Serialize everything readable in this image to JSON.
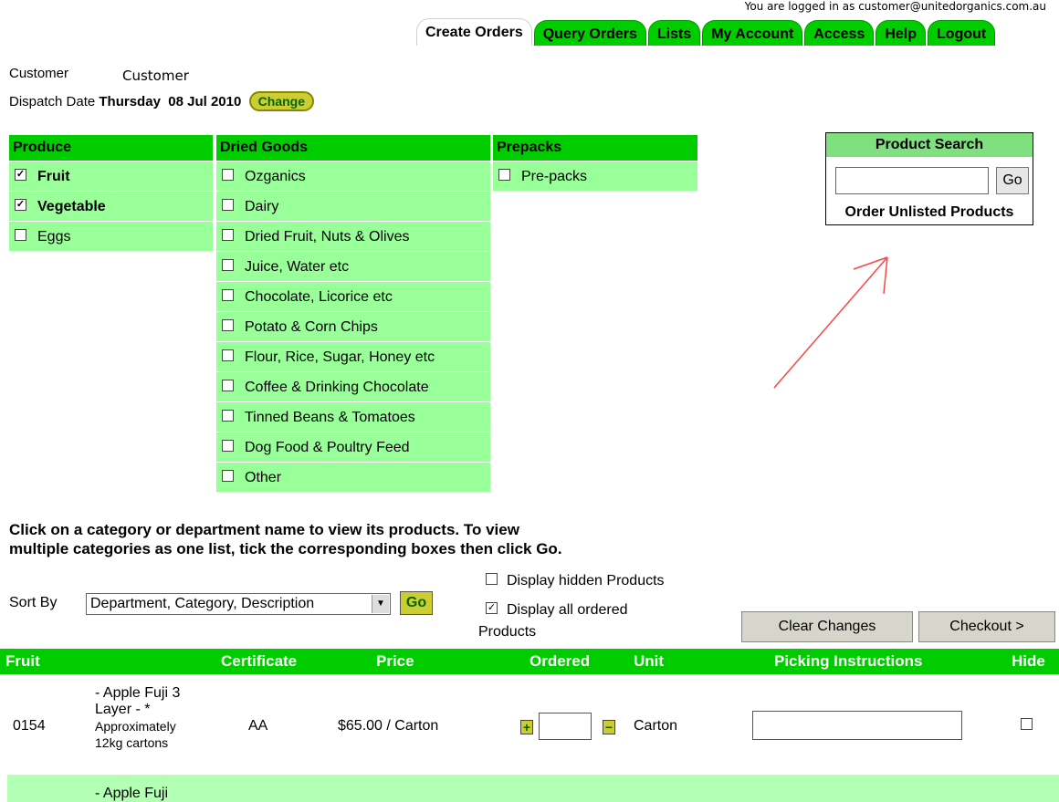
{
  "header": {
    "logged_in_text": "You are logged in as customer@unitedorganics.com.au",
    "tabs": [
      {
        "label": "Create Orders",
        "active": true
      },
      {
        "label": "Query Orders"
      },
      {
        "label": "Lists"
      },
      {
        "label": "My Account"
      },
      {
        "label": "Access"
      },
      {
        "label": "Help"
      },
      {
        "label": "Logout"
      }
    ]
  },
  "info": {
    "customer_label": "Customer",
    "customer_value": "Customer",
    "dispatch_label": "Dispatch Date",
    "dispatch_day": "Thursday",
    "dispatch_date": "08 Jul 2010",
    "change_label": "Change"
  },
  "categories": {
    "produce": {
      "title": "Produce",
      "items": [
        {
          "label": "Fruit",
          "checked": true
        },
        {
          "label": "Vegetable",
          "checked": true
        },
        {
          "label": "Eggs",
          "checked": false
        }
      ]
    },
    "dried_goods": {
      "title": "Dried Goods",
      "items": [
        {
          "label": "Ozganics"
        },
        {
          "label": "Dairy"
        },
        {
          "label": "Dried Fruit, Nuts & Olives"
        },
        {
          "label": "Juice, Water etc"
        },
        {
          "label": "Chocolate, Licorice etc"
        },
        {
          "label": "Potato & Corn Chips"
        },
        {
          "label": "Flour, Rice, Sugar, Honey etc"
        },
        {
          "label": "Coffee & Drinking Chocolate"
        },
        {
          "label": "Tinned Beans & Tomatoes"
        },
        {
          "label": "Dog Food & Poultry Feed"
        },
        {
          "label": "Other"
        }
      ]
    },
    "prepacks": {
      "title": "Prepacks",
      "items": [
        {
          "label": "Pre-packs"
        }
      ]
    }
  },
  "search": {
    "title": "Product Search",
    "go_label": "Go",
    "unlisted_label": "Order Unlisted Products"
  },
  "instructions": {
    "line1": "Click on a category or department name to view its products. To view",
    "line2": "multiple categories as one list, tick the corresponding boxes then click Go."
  },
  "sort": {
    "label": "Sort By",
    "selected": "Department, Category, Description",
    "go_label": "Go"
  },
  "options": {
    "hidden_label": "Display hidden Products",
    "ordered_label_1": "Display all ordered",
    "ordered_label_2": "Products"
  },
  "actions": {
    "clear_label": "Clear Changes",
    "checkout_label": "Checkout >"
  },
  "table": {
    "headers": {
      "fruit": "Fruit",
      "certificate": "Certificate",
      "price": "Price",
      "ordered": "Ordered",
      "unit": "Unit",
      "picking": "Picking Instructions",
      "hide": "Hide"
    },
    "rows": [
      {
        "code": "0154",
        "desc_lines": [
          "- Apple Fuji 3",
          "Layer - *"
        ],
        "desc_small": [
          "Approximately",
          "12kg cartons"
        ],
        "certificate": "AA",
        "price": "$65.00 / Carton",
        "unit": "Carton",
        "plus": "+",
        "minus": "−"
      },
      {
        "desc_partial": "- Apple Fuji"
      }
    ]
  },
  "colors": {
    "header_green": "#00cc00",
    "light_green": "#99ff99",
    "button_yellow": "#cccc33",
    "arrow_red": "#ff4444"
  }
}
